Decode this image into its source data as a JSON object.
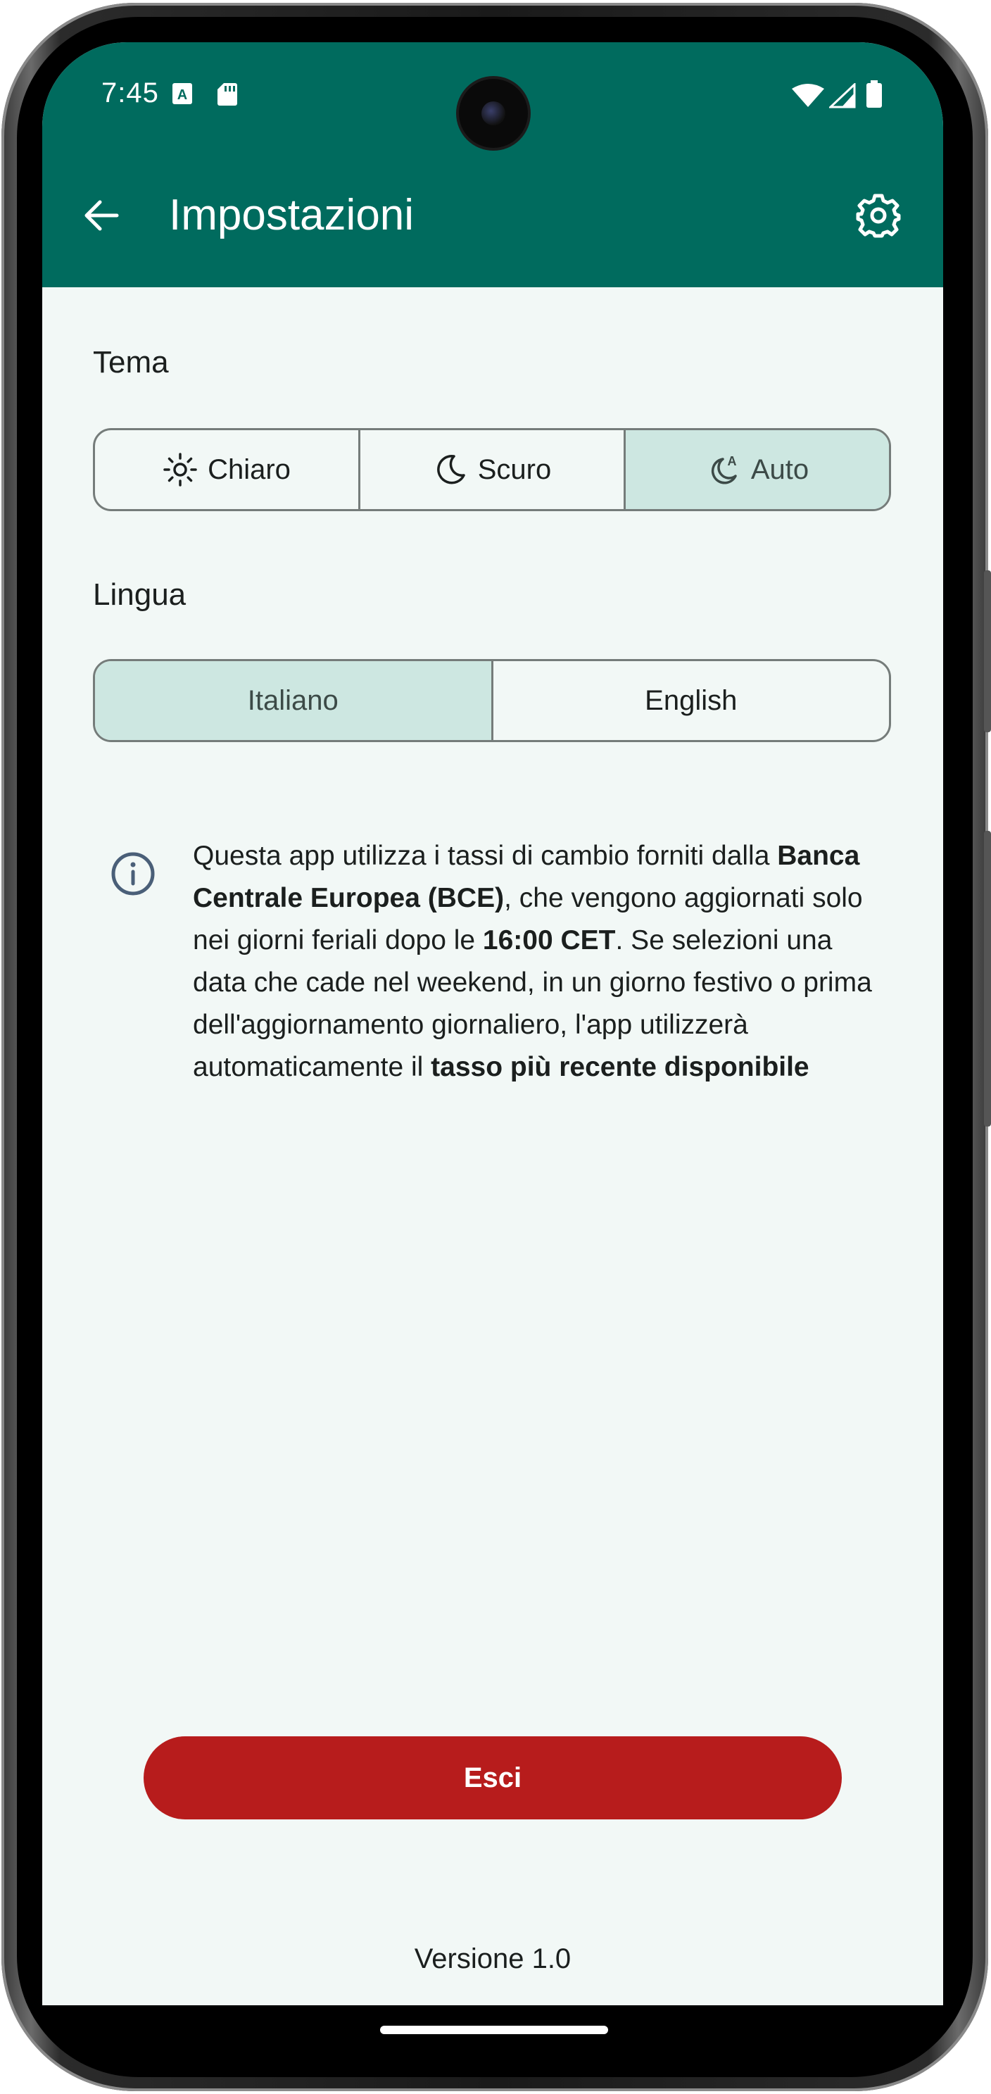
{
  "status_bar": {
    "time": "7:45",
    "icons": [
      "a-badge-icon",
      "sd-card-icon",
      "wifi-icon",
      "signal-icon",
      "battery-icon"
    ]
  },
  "app_bar": {
    "title": "Impostazioni",
    "back_icon": "arrow-back-icon",
    "settings_icon": "gear-icon",
    "color": "#006b5e"
  },
  "theme": {
    "label": "Tema",
    "options": [
      {
        "label": "Chiaro",
        "icon": "sun-icon",
        "selected": false
      },
      {
        "label": "Scuro",
        "icon": "moon-icon",
        "selected": false
      },
      {
        "label": "Auto",
        "icon": "moon-auto-icon",
        "selected": true
      }
    ]
  },
  "language": {
    "label": "Lingua",
    "options": [
      {
        "label": "Italiano",
        "selected": true
      },
      {
        "label": "English",
        "selected": false
      }
    ]
  },
  "info": {
    "icon": "info-icon",
    "text_1": "Questa app utilizza i tassi di cambio forniti dalla ",
    "bold_1": "Banca Centrale Europea (BCE)",
    "text_2": ", che vengono aggiornati solo nei giorni feriali dopo le ",
    "bold_2": "16:00 CET",
    "text_3": ". Se selezioni una data che cade nel weekend, in un giorno festivo o prima dell'aggiornamento giornaliero, l'app utilizzerà automaticamente il ",
    "bold_3": "tasso più recente disponibile"
  },
  "exit_button": {
    "label": "Esci",
    "color": "#b71c1c"
  },
  "version": "Versione 1.0",
  "colors": {
    "selected_segment": "#cde7e1",
    "background": "#f2f8f6"
  }
}
